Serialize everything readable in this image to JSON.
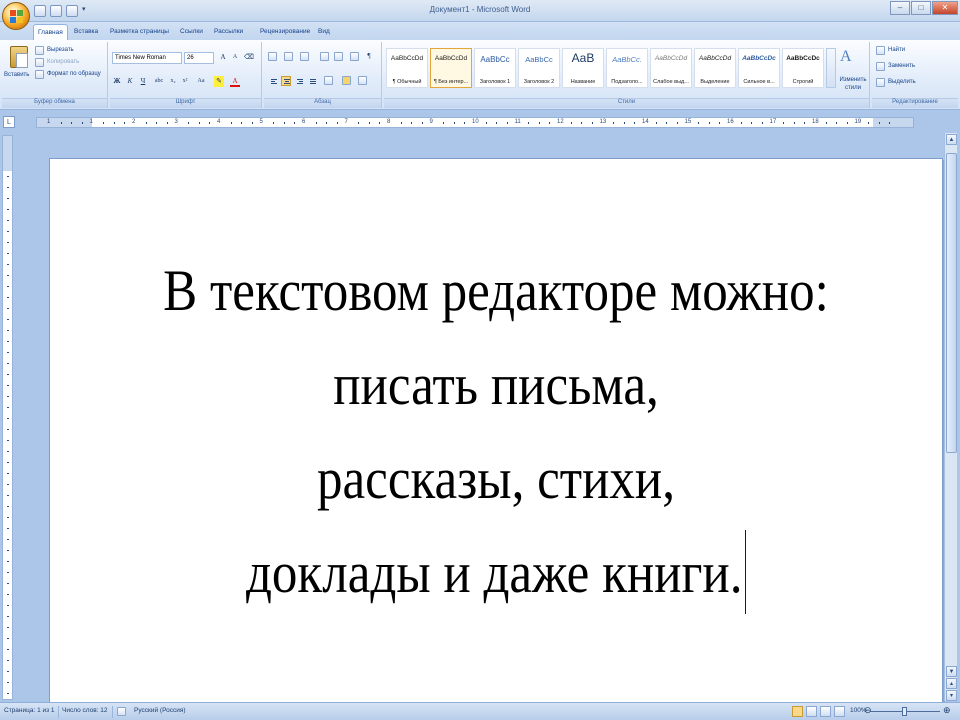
{
  "window": {
    "title": "Документ1 - Microsoft Word",
    "controls": {
      "minimize": "–",
      "maximize": "□",
      "close": "✕"
    }
  },
  "tabs": [
    "Главная",
    "Вставка",
    "Разметка страницы",
    "Ссылки",
    "Рассылки",
    "Рецензирование",
    "Вид"
  ],
  "ribbon": {
    "clipboard": {
      "paste_label": "Вставить",
      "cut_label": "Вырезать",
      "copy_label": "Копировать",
      "format_painter_label": "Формат по образцу",
      "group_label": "Буфер обмена"
    },
    "font": {
      "font_name": "Times New Roman",
      "font_size": "26",
      "group_label": "Шрифт"
    },
    "paragraph": {
      "group_label": "Абзац"
    },
    "styles": {
      "group_label": "Стили",
      "change_styles_label": "Изменить стили",
      "tiles": [
        {
          "preview": "AaBbCcDd",
          "name": "¶ Обычный"
        },
        {
          "preview": "AaBbCcDd",
          "name": "¶ Без интер..."
        },
        {
          "preview": "AaBbCc",
          "name": "Заголовок 1"
        },
        {
          "preview": "AaBbCc",
          "name": "Заголовок 2"
        },
        {
          "preview": "AaB",
          "name": "Название"
        },
        {
          "preview": "AaBbCc.",
          "name": "Подзаголо..."
        },
        {
          "preview": "AaBbCcDd",
          "name": "Слабое выд..."
        },
        {
          "preview": "AaBbCcDd",
          "name": "Выделение"
        },
        {
          "preview": "AaBbCcDc",
          "name": "Сильное в..."
        },
        {
          "preview": "AaBbCcDc",
          "name": "Строгий"
        }
      ]
    },
    "editing": {
      "group_label": "Редактирование",
      "find_label": "Найти",
      "replace_label": "Заменить",
      "select_label": "Выделить"
    }
  },
  "ruler": {
    "numbers": [
      "1",
      "1",
      "2",
      "3",
      "4",
      "5",
      "6",
      "7",
      "8",
      "9",
      "10",
      "11",
      "12",
      "13",
      "14",
      "15",
      "16",
      "17",
      "18",
      "19"
    ]
  },
  "document": {
    "lines": [
      "В текстовом редакторе можно:",
      "писать письма,",
      "рассказы, стихи,",
      "доклады и даже книги."
    ]
  },
  "statusbar": {
    "page": "Страница: 1 из 1",
    "words": "Число слов: 12",
    "language": "Русский (Россия)",
    "zoom": "100%"
  },
  "colors": {
    "ribbon_blue": "#15428b",
    "frame_blue": "#abc6e8",
    "active_style": "#e4a53a"
  }
}
